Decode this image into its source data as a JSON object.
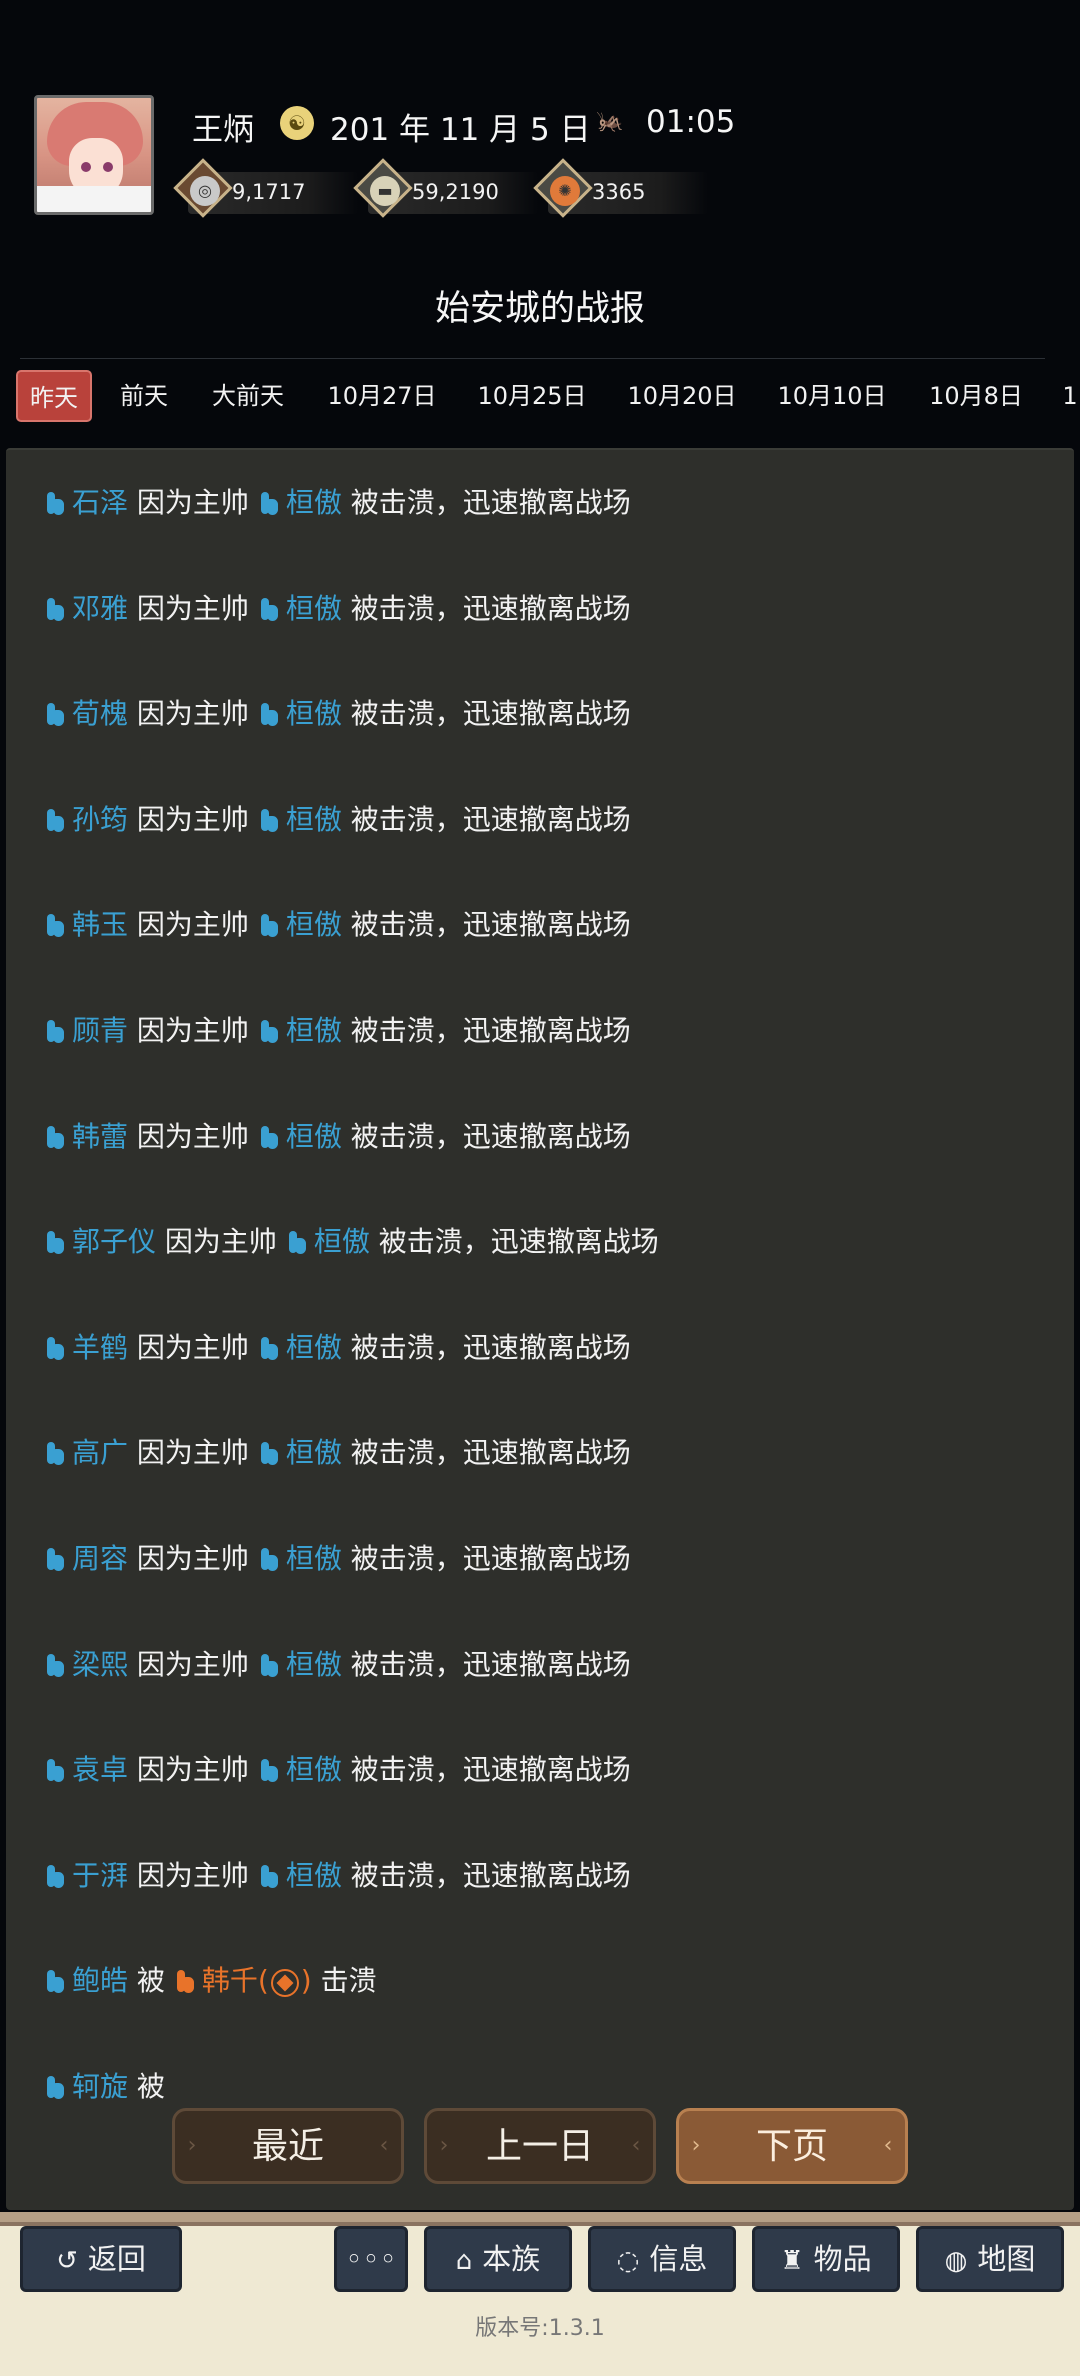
{
  "header": {
    "player_name": "王炳",
    "date": "201 年 11 月 5 日",
    "time": "01:05",
    "date_icon_glyph": "☯",
    "time_icon_glyph": "🦗"
  },
  "resources": [
    {
      "name": "silver",
      "value": "9,1717",
      "icon": "coin-icon",
      "color": "#c9c9c9"
    },
    {
      "name": "grain",
      "value": "59,2190",
      "icon": "grain-icon",
      "color": "#d8d2b8"
    },
    {
      "name": "troops",
      "value": "3365",
      "icon": "troops-icon",
      "color": "#e07a3a"
    }
  ],
  "page_title": "始安城的战报",
  "tabs": [
    {
      "label": "昨天",
      "active": true
    },
    {
      "label": "前天",
      "active": false
    },
    {
      "label": "大前天",
      "active": false
    },
    {
      "label": "10月27日",
      "active": false
    },
    {
      "label": "10月25日",
      "active": false
    },
    {
      "label": "10月20日",
      "active": false
    },
    {
      "label": "10月10日",
      "active": false
    },
    {
      "label": "10月8日",
      "active": false
    },
    {
      "label": "1",
      "active": false
    }
  ],
  "report": {
    "commander": "桓傲",
    "connector": "因为主帅",
    "outcome": "被击溃，迅速撤离战场",
    "retreated": [
      "石泽",
      "邓雅",
      "荀槐",
      "孙筠",
      "韩玉",
      "顾青",
      "韩蕾",
      "郭子仪",
      "羊鹤",
      "高广",
      "周容",
      "梁熙",
      "袁卓",
      "于湃"
    ],
    "defeat": {
      "name": "鲍皓",
      "by": "被",
      "enemy": "韩千(",
      "enemy_suffix": ")",
      "result": "击溃"
    },
    "partial": {
      "name": "轲旋",
      "by": "被"
    }
  },
  "nav_buttons": {
    "recent": "最近",
    "prev_day": "上一日",
    "next_page": "下页"
  },
  "bottom_bar": {
    "back": "返回",
    "more": "◦◦◦",
    "clan": "本族",
    "info": "信息",
    "items": "物品",
    "map": "地图",
    "version": "版本号:1.3.1"
  }
}
